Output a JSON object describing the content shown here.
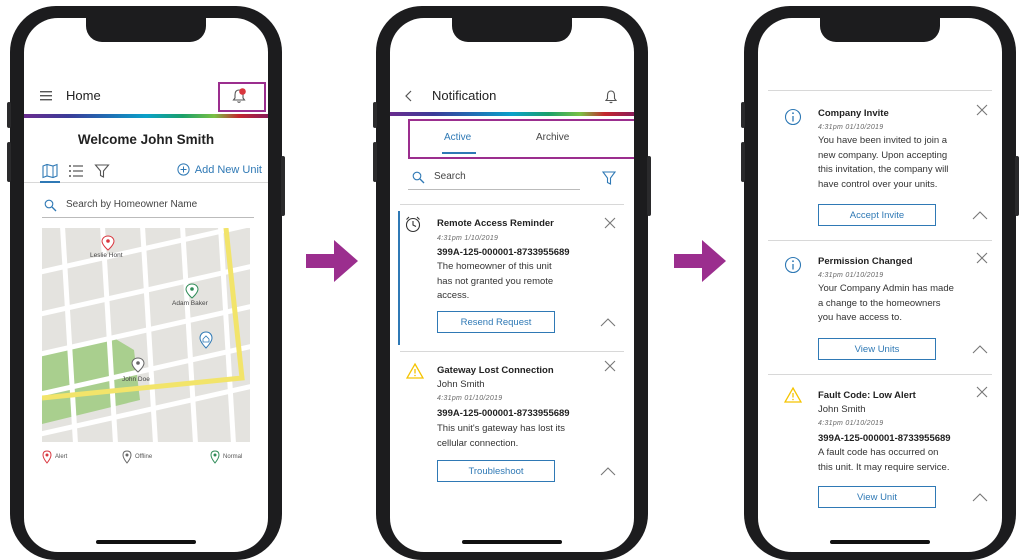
{
  "colors": {
    "accent": "#2f79b5",
    "highlight": "#9b2e8e",
    "alert": "#d9363e",
    "offline": "#666666",
    "normal": "#2e8b57",
    "warning": "#f5c400"
  },
  "screen1": {
    "title": "Home",
    "welcome": "Welcome John Smith",
    "add_unit": "Add New Unit",
    "search_placeholder": "Search by Homeowner Name",
    "map_labels": {
      "leslie": "Leslie Hont",
      "adam": "Adam Baker",
      "john": "John Doe"
    },
    "legend": {
      "alert": "Alert",
      "offline": "Offline",
      "normal": "Normal"
    }
  },
  "screen2": {
    "title": "Notification",
    "tabs": {
      "active": "Active",
      "archive": "Archive"
    },
    "search_placeholder": "Search",
    "cards": [
      {
        "title": "Remote Access Reminder",
        "time": "4:31pm    1/10/2019",
        "id": "399A-125-000001-8733955689",
        "body": [
          "The homeowner of this unit",
          "has not granted you remote",
          "access."
        ],
        "button": "Resend Request"
      },
      {
        "title": "Gateway Lost Connection",
        "subtitle": "John Smith",
        "time": "4:31pm    01/10/2019",
        "id": "399A-125-000001-8733955689",
        "body": [
          "This unit's gateway has lost its",
          "cellular connection."
        ],
        "button": "Troubleshoot"
      }
    ]
  },
  "screen3": {
    "cards": [
      {
        "title": "Company Invite",
        "time": "4:31pm      01/10/2019",
        "body": [
          "You have been invited to join a",
          "new company. Upon accepting",
          "this invitation, the company will",
          "have control over your units."
        ],
        "button": "Accept Invite"
      },
      {
        "title": "Permission Changed",
        "time": "4:31pm      01/10/2019",
        "body": [
          "Your Company Admin has made",
          "a change to the homeowners",
          "you have access to."
        ],
        "button": "View Units"
      },
      {
        "title": "Fault Code: Low Alert",
        "subtitle": "John Smith",
        "time": "4:31pm    01/10/2019",
        "id": "399A-125-000001-8733955689",
        "body": [
          "A fault code has occurred on",
          "this unit. It may require service."
        ],
        "button": "View Unit"
      }
    ]
  }
}
